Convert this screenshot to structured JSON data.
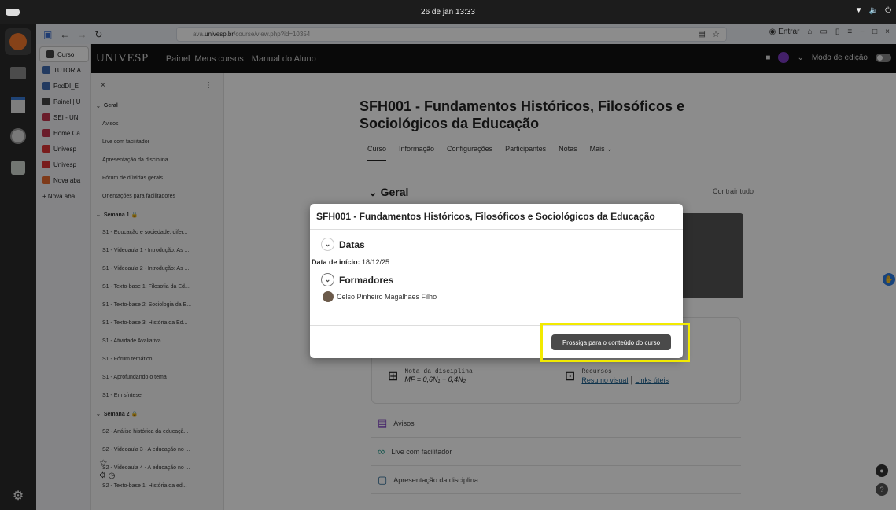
{
  "system": {
    "clock": "26 de jan  13:33"
  },
  "browser": {
    "url_prefix": "ava.",
    "url_host": "univesp.br",
    "url_path": "/course/view.php?id=10354",
    "account_label": "Entrar"
  },
  "tabs": [
    {
      "label": "Curso",
      "color": "#444"
    },
    {
      "label": "TUTORIA",
      "color": "#3f6ab0"
    },
    {
      "label": "PodDI_E",
      "color": "#3f6ab0"
    },
    {
      "label": "Painel | U",
      "color": "#444"
    },
    {
      "label": "SEI - UNI",
      "color": "#c2334d"
    },
    {
      "label": "Home Ca",
      "color": "#c2334d"
    },
    {
      "label": "Univesp",
      "color": "#d33"
    },
    {
      "label": "Univesp",
      "color": "#d33"
    },
    {
      "label": "Nova aba",
      "color": "#e66b2f"
    },
    {
      "label": "+ Nova aba",
      "color": "transparent"
    }
  ],
  "navbar": {
    "brand": "UNIVESP",
    "links": [
      "Painel",
      "Meus cursos",
      "Manual do Aluno"
    ],
    "edit_mode": "Modo de edição"
  },
  "drawer": {
    "close": "×",
    "menu": "⋮",
    "items": [
      {
        "label": "Geral",
        "section": true
      },
      {
        "label": "Avisos"
      },
      {
        "label": "Live com facilitador"
      },
      {
        "label": "Apresentação da disciplina"
      },
      {
        "label": "Fórum de dúvidas gerais"
      },
      {
        "label": "Orientações para facilitadores"
      },
      {
        "label": "Semana 1 🔒",
        "section": true
      },
      {
        "label": "S1 - Educação e sociedade: difer..."
      },
      {
        "label": "S1 - Videoaula 1 - Introdução: As ..."
      },
      {
        "label": "S1 - Videoaula 2 - Introdução: As ..."
      },
      {
        "label": "S1 - Texto-base 1: Filosofia da Ed..."
      },
      {
        "label": "S1 - Texto-base 2: Sociologia da E..."
      },
      {
        "label": "S1 - Texto-base 3: História da Ed..."
      },
      {
        "label": "S1 - Atividade Avaliativa"
      },
      {
        "label": "S1 - Fórum temático"
      },
      {
        "label": "S1 - Aprofundando o tema"
      },
      {
        "label": "S1 - Em síntese"
      },
      {
        "label": "Semana 2 🔒",
        "section": true
      },
      {
        "label": "S2 - Análise histórica da educaçã..."
      },
      {
        "label": "S2 - Videoaula 3 - A educação no ..."
      },
      {
        "label": "S2 - Videoaula 4 - A educação no ..."
      },
      {
        "label": "S2 - Texto-base 1: História da ed..."
      }
    ]
  },
  "course": {
    "title": "SFH001 - Fundamentos Históricos, Filosóficos e Sociológicos da Educação",
    "tabs": [
      "Curso",
      "Informação",
      "Configurações",
      "Participantes",
      "Notas",
      "Mais ⌄"
    ],
    "section_title": "Geral",
    "collapse_all": "Contrair tudo",
    "grade_label": "Nota da disciplina",
    "grade_formula": "MF = 0,6N₁ + 0,4N₂",
    "resources_label": "Recursos",
    "resources_link1": "Resumo visual",
    "resources_sep": "|",
    "resources_link2": "Links úteis",
    "activities": [
      "Avisos",
      "Live com facilitador",
      "Apresentação da disciplina"
    ]
  },
  "modal": {
    "title": "SFH001 - Fundamentos Históricos, Filosóficos e Sociológicos da Educação",
    "dates_heading": "Datas",
    "start_label": "Data de início:",
    "start_value": "18/12/25",
    "teachers_heading": "Formadores",
    "teacher_name": "Celso Pinheiro Magalhaes Filho",
    "proceed_button": "Prossiga para o conteúdo do curso"
  }
}
